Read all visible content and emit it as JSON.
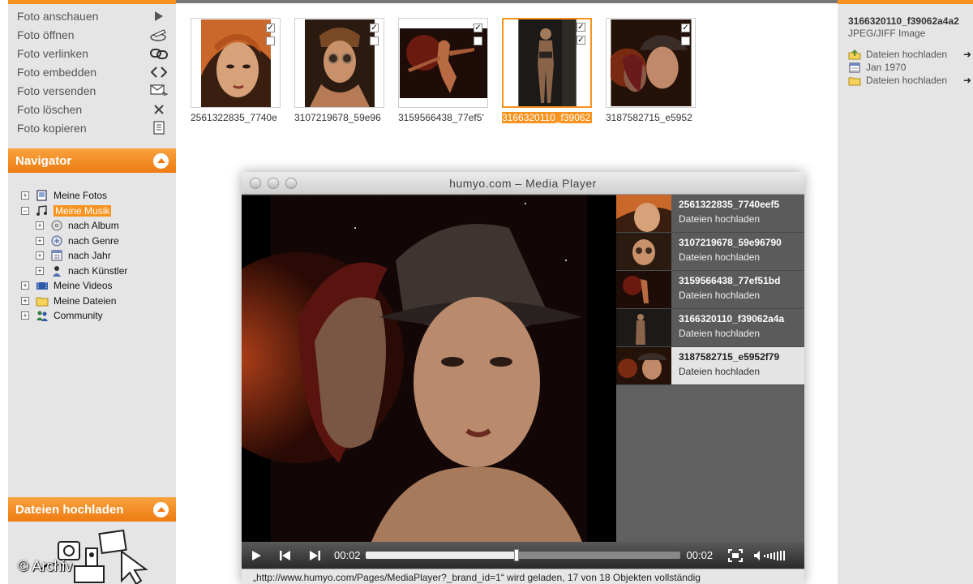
{
  "actions": [
    {
      "label": "Foto anschauen",
      "icon": "play-arrow-icon"
    },
    {
      "label": "Foto öffnen",
      "icon": "open-disk-icon"
    },
    {
      "label": "Foto verlinken",
      "icon": "link-icon"
    },
    {
      "label": "Foto embedden",
      "icon": "embed-code-icon"
    },
    {
      "label": "Foto versenden",
      "icon": "envelope-send-icon"
    },
    {
      "label": "Foto löschen",
      "icon": "delete-x-icon"
    },
    {
      "label": "Foto kopieren",
      "icon": "copy-document-icon"
    }
  ],
  "navigator": {
    "title": "Navigator",
    "items": [
      {
        "label": "Meine Fotos",
        "toggle": "+"
      },
      {
        "label": "Meine Musik",
        "toggle": "−",
        "selected": true
      },
      {
        "label": "nach Album",
        "toggle": "+",
        "child": true
      },
      {
        "label": "nach Genre",
        "toggle": "+",
        "child": true
      },
      {
        "label": "nach Jahr",
        "toggle": "+",
        "child": true
      },
      {
        "label": "nach Künstler",
        "toggle": "+",
        "child": true
      },
      {
        "label": "Meine Videos",
        "toggle": "+"
      },
      {
        "label": "Meine Dateien",
        "toggle": "+"
      },
      {
        "label": "Community",
        "toggle": "+"
      }
    ]
  },
  "upload_panel": {
    "title": "Dateien hochladen"
  },
  "watermark": "© Archiv",
  "thumbnails": [
    {
      "label": "2561322835_7740e",
      "checked": false,
      "selected": false
    },
    {
      "label": "3107219678_59e96",
      "checked": false,
      "selected": false
    },
    {
      "label": "3159566438_77ef5'",
      "checked": false,
      "selected": false
    },
    {
      "label": "3166320110_f39062",
      "checked": true,
      "selected": true
    },
    {
      "label": "3187582715_e5952",
      "checked": false,
      "selected": false
    }
  ],
  "file_info": {
    "name": "3166320110_f39062a4a2",
    "type": "JPEG/JIFF Image",
    "meta": [
      {
        "label": "Dateien hochladen",
        "icon": "upload-folder-icon",
        "arrow": "➜"
      },
      {
        "label": "Jan 1970",
        "icon": "calendar-icon",
        "arrow": ""
      },
      {
        "label": "Dateien hochladen",
        "icon": "folder-icon",
        "arrow": "➜"
      }
    ]
  },
  "player": {
    "title": "humyo.com – Media Player",
    "playlist": [
      {
        "title": "2561322835_7740eef5",
        "sub": "Dateien hochladen",
        "active": false
      },
      {
        "title": "3107219678_59e96790",
        "sub": "Dateien hochladen",
        "active": false
      },
      {
        "title": "3159566438_77ef51bd",
        "sub": "Dateien hochladen",
        "active": false
      },
      {
        "title": "3166320110_f39062a4a",
        "sub": "Dateien hochladen",
        "active": false
      },
      {
        "title": "3187582715_e5952f79",
        "sub": "Dateien hochladen",
        "active": true
      }
    ],
    "time_current": "00:02",
    "time_total": "00:02",
    "progress": 0.48,
    "status": "„http://www.humyo.com/Pages/MediaPlayer?_brand_id=1“ wird geladen, 17 von 18 Objekten vollständig"
  }
}
